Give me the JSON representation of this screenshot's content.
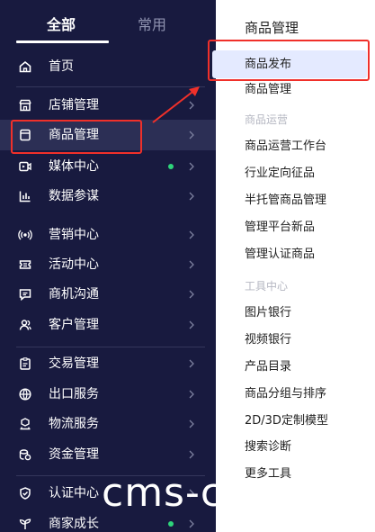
{
  "tabs": {
    "all": "全部",
    "common": "常用"
  },
  "nav": [
    {
      "label": "首页",
      "icon": "home-icon",
      "arrow": false,
      "dot": false
    },
    {
      "label": "店铺管理",
      "icon": "store-icon",
      "arrow": true,
      "dot": false
    },
    {
      "label": "商品管理",
      "icon": "product-icon",
      "arrow": true,
      "dot": false,
      "selected": true
    },
    {
      "label": "媒体中心",
      "icon": "media-icon",
      "arrow": true,
      "dot": true
    },
    {
      "label": "数据参谋",
      "icon": "chart-icon",
      "arrow": true,
      "dot": false
    },
    {
      "label": "营销中心",
      "icon": "broadcast-icon",
      "arrow": true,
      "dot": false
    },
    {
      "label": "活动中心",
      "icon": "ticket-icon",
      "arrow": true,
      "dot": false
    },
    {
      "label": "商机沟通",
      "icon": "chat-icon",
      "arrow": true,
      "dot": false
    },
    {
      "label": "客户管理",
      "icon": "users-icon",
      "arrow": true,
      "dot": false
    },
    {
      "label": "交易管理",
      "icon": "clipboard-icon",
      "arrow": true,
      "dot": false
    },
    {
      "label": "出口服务",
      "icon": "globe-icon",
      "arrow": true,
      "dot": false
    },
    {
      "label": "物流服务",
      "icon": "truck-icon",
      "arrow": true,
      "dot": false
    },
    {
      "label": "资金管理",
      "icon": "coins-icon",
      "arrow": true,
      "dot": false
    },
    {
      "label": "认证中心",
      "icon": "shield-icon",
      "arrow": true,
      "dot": false
    },
    {
      "label": "商家成长",
      "icon": "sprout-icon",
      "arrow": true,
      "dot": true
    }
  ],
  "submenu": {
    "title": "商品管理",
    "items": [
      {
        "type": "item",
        "label": "商品发布",
        "highlighted": true
      },
      {
        "type": "item",
        "label": "商品管理"
      },
      {
        "type": "group",
        "label": "商品运营"
      },
      {
        "type": "item",
        "label": "商品运营工作台"
      },
      {
        "type": "item",
        "label": "行业定向征品"
      },
      {
        "type": "item",
        "label": "半托管商品管理"
      },
      {
        "type": "item",
        "label": "管理平台新品"
      },
      {
        "type": "item",
        "label": "管理认证商品"
      },
      {
        "type": "group",
        "label": "工具中心"
      },
      {
        "type": "item",
        "label": "图片银行"
      },
      {
        "type": "item",
        "label": "视频银行"
      },
      {
        "type": "item",
        "label": "产品目录"
      },
      {
        "type": "item",
        "label": "商品分组与排序"
      },
      {
        "type": "item",
        "label": "2D/3D定制模型"
      },
      {
        "type": "item",
        "label": "搜索诊断"
      },
      {
        "type": "item",
        "label": "更多工具"
      }
    ]
  },
  "watermark": "cms-c",
  "colors": {
    "sidebar_bg": "#181a3f",
    "selected_bg": "#2c2f55",
    "highlight_bg": "#e4eaff",
    "annotation_red": "#f0302a",
    "status_dot": "#2ed47a"
  }
}
